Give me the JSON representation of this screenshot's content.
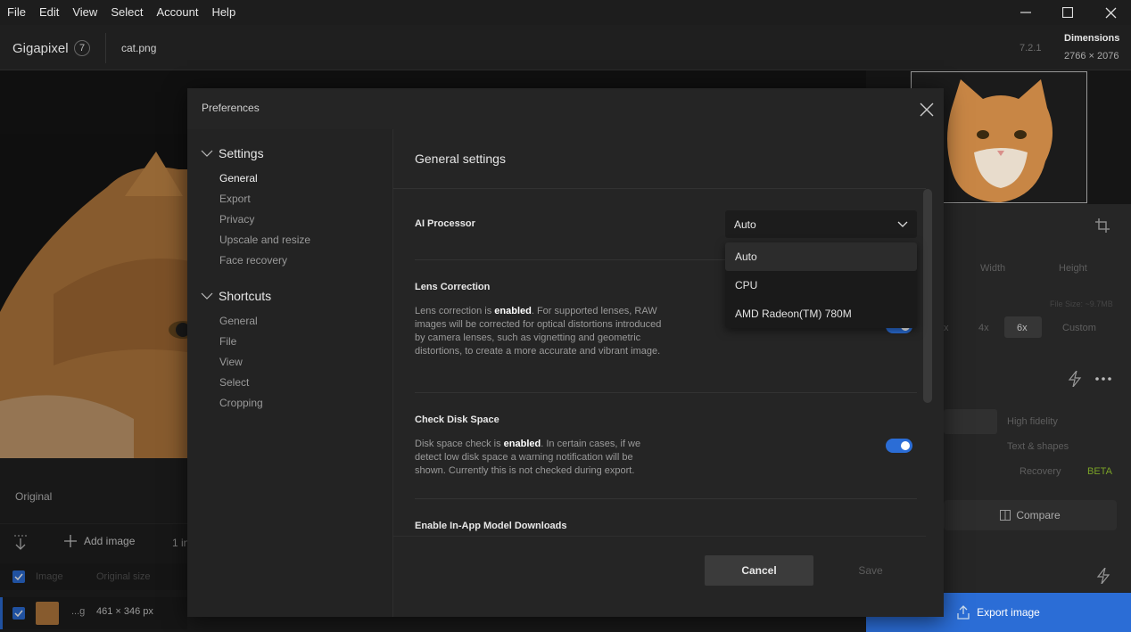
{
  "menubar": {
    "items": [
      "File",
      "Edit",
      "View",
      "Select",
      "Account",
      "Help"
    ]
  },
  "window_controls": {
    "minimize": "minimize-icon",
    "maximize": "maximize-icon",
    "close": "close-icon"
  },
  "header": {
    "app_name": "Gigapixel",
    "badge": "7",
    "file_name": "cat.png",
    "version": "7.2.1",
    "dimensions_label": "Dimensions",
    "dimensions_value": "2766 × 2076"
  },
  "workspace": {
    "original_label": "Original",
    "add_image": "Add image",
    "image_count_partial": "1 in",
    "table_headers": [
      "Image",
      "Original size"
    ],
    "row": {
      "name_partial": "...g",
      "size": "461 × 346 px"
    }
  },
  "right_panel": {
    "size_fields": [
      "Width",
      "Height"
    ],
    "file_size": "File Size: ~9.7MB",
    "scales": [
      "x",
      "4x",
      "6x",
      "Custom"
    ],
    "selected_scale": "6x",
    "models": [
      "High fidelity",
      "Text & shapes",
      "Recovery"
    ],
    "beta": "BETA",
    "compare": "Compare",
    "export": "Export image"
  },
  "dialog": {
    "title": "Preferences",
    "sidebar": {
      "sections": [
        {
          "title": "Settings",
          "items": [
            "General",
            "Export",
            "Privacy",
            "Upscale and resize",
            "Face recovery"
          ]
        },
        {
          "title": "Shortcuts",
          "items": [
            "General",
            "File",
            "View",
            "Select",
            "Cropping"
          ]
        }
      ],
      "active_item": "General"
    },
    "content_title": "General settings",
    "ai_processor": {
      "label": "AI Processor",
      "value": "Auto",
      "options": [
        "Auto",
        "CPU",
        "AMD Radeon(TM) 780M"
      ]
    },
    "lens": {
      "title": "Lens Correction",
      "pre": "Lens correction is ",
      "state": "enabled",
      "post": ". For supported lenses, RAW images will be corrected for optical distortions introduced by camera lenses, such as vignetting and geometric distortions, to create a more accurate and vibrant image.",
      "enabled": true
    },
    "disk": {
      "title": "Check Disk Space",
      "pre": "Disk space check is ",
      "state": "enabled",
      "post": ". In certain cases, if we detect low disk space a warning notification will be shown. Currently this is not checked during export.",
      "enabled": true
    },
    "downloads_title": "Enable In-App Model Downloads",
    "cancel": "Cancel",
    "save": "Save"
  },
  "colors": {
    "accent": "#2b6dd6",
    "dialog_bg": "#252525",
    "app_bg": "#202020"
  }
}
